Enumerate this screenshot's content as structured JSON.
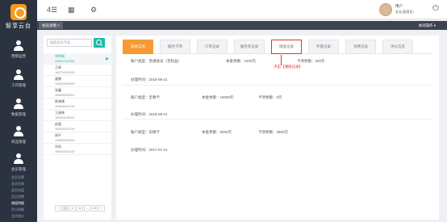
{
  "app": {
    "logo_text": "智享云台"
  },
  "sidebar": {
    "items": [
      {
        "label": "营销运营"
      },
      {
        "label": "工作管理"
      },
      {
        "label": "数据管理"
      },
      {
        "label": "商品管理"
      },
      {
        "label": "会员管理"
      }
    ],
    "sub_items": [
      {
        "label": "会员设置"
      },
      {
        "label": "会员列表"
      },
      {
        "label": "会员充值"
      },
      {
        "label": "会员消费"
      },
      {
        "label": "储值明细"
      },
      {
        "label": "积分明细"
      },
      {
        "label": "会员统计"
      }
    ]
  },
  "topbar": {
    "menu_icon": "hamburger-icon",
    "grid_icon": "grid-icon",
    "settings_icon": "gear-icon",
    "user_name": "用户",
    "user_role": "会长(管理员)"
  },
  "tabstrip": {
    "open_tab": "会员详情 ×",
    "close_ops": "关闭操作 ▾"
  },
  "member_list": {
    "search_placeholder": "搜索会员/手机",
    "members": [
      {
        "name": "李明娟",
        "phone": "15601011550",
        "selected": true
      },
      {
        "name": "王辉",
        "phone": "18271001055",
        "selected": false
      },
      {
        "name": "姜鹏",
        "phone": "15602000020",
        "selected": false
      },
      {
        "name": "张鑫",
        "phone": "15600000021",
        "selected": false
      },
      {
        "name": "陈晓康",
        "phone": "15600001310",
        "selected": false
      },
      {
        "name": "王晓晓",
        "phone": "15001003101",
        "selected": false
      },
      {
        "name": "赵磊",
        "phone": "15001001310",
        "selected": false
      },
      {
        "name": "周平",
        "phone": "13552000260",
        "selected": false
      },
      {
        "name": "刘凤",
        "phone": "15601001010",
        "selected": false
      }
    ],
    "pager": [
      "‹",
      "1",
      "2",
      "3",
      "...",
      "12",
      "›"
    ]
  },
  "detail": {
    "tabs": [
      "基本信息",
      "服务卡项",
      "订单记录",
      "服务单记录",
      "储值记录",
      "存量记录",
      "消费记录",
      "评价信息"
    ],
    "annotation": "点击【储值记录】",
    "cards": [
      {
        "type": "账户类型：普通会员（无权益）",
        "principal": "本金余额：1200元",
        "card_balance": "卡项余额：200元",
        "date": "办理时间：2018-08-21"
      },
      {
        "type": "账户类型：至尊卡",
        "principal": "本金余额：15000元",
        "card_balance": "卡项余额：0元",
        "date": "办理时间：2018-08-21"
      },
      {
        "type": "账户类型：白银卡",
        "principal": "本金余额：6000元",
        "card_balance": "卡项余额：3500元",
        "date": "办理时间：2017-07-14"
      }
    ]
  },
  "colors": {
    "accent": "#f79a33",
    "teal": "#1fbba6",
    "sidebar": "#2b3240",
    "annotation": "#e0332b"
  }
}
